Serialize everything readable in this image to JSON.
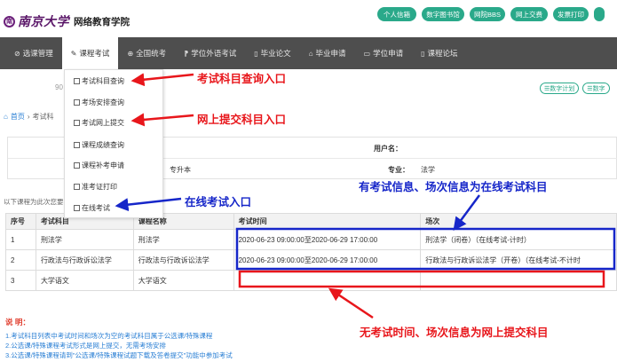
{
  "header": {
    "logo_mark": "南",
    "univ_name": "南京大学",
    "school_name": "网络教育学院",
    "buttons": [
      "个人信箱",
      "数字图书馆",
      "网院BBS",
      "网上交费",
      "发票打印"
    ]
  },
  "nav": {
    "items": [
      {
        "icon": "⊘",
        "label": "选课管理"
      },
      {
        "icon": "✎",
        "label": "课程考试"
      },
      {
        "icon": "⊕",
        "label": "全国统考"
      },
      {
        "icon": "⁋",
        "label": "学位外语考试"
      },
      {
        "icon": "▯",
        "label": "毕业论文"
      },
      {
        "icon": "⌂",
        "label": "毕业申请"
      },
      {
        "icon": "▭",
        "label": "学位申请"
      },
      {
        "icon": "▯",
        "label": "课程论坛"
      }
    ]
  },
  "dropdown": {
    "items": [
      "考试科目查询",
      "考场安排查询",
      "考试网上提交",
      "课程成绩查询",
      "课程补考申请",
      "准考证打印",
      "在线考试"
    ]
  },
  "breadcrumb": {
    "home": "首页",
    "current": "考试科"
  },
  "left_number": "90",
  "plan_buttons": [
    "数字计划",
    "数字"
  ],
  "info": {
    "username_label": "用户名：",
    "username_value": "",
    "level": "专升本",
    "major_label": "专业：",
    "major_value": "法学"
  },
  "hint": "以下课程为此次您要",
  "table": {
    "headers": [
      "序号",
      "考试科目",
      "课程名称",
      "考试时间",
      "场次"
    ],
    "rows": [
      [
        "1",
        "刑法学",
        "刑法学",
        "2020-06-23 09:00:00至2020-06-29 17:00:00",
        "刑法学（闭卷）（在线考试-计时）"
      ],
      [
        "2",
        "行政法与行政诉讼法学",
        "行政法与行政诉讼法学",
        "2020-06-23 09:00:00至2020-06-29 17:00:00",
        "行政法与行政诉讼法学（开卷）（在线考试-不计时"
      ],
      [
        "3",
        "大学语文",
        "大学语文",
        "",
        ""
      ]
    ]
  },
  "notes": {
    "title": "说 明：",
    "lines": [
      "1.考试科目列表中考试时间和场次为空的考试科目属于公选课/特殊课程",
      "2.公选课/特殊课程考试形式是网上提交，无需考场安排",
      "3.公选课/特殊课程请到\"公选课/特殊课程试题下载及答卷提交\"功能中参加考试"
    ]
  },
  "annotations": {
    "query_entry": "考试科目查询入口",
    "submit_entry": "网上提交科目入口",
    "online_entry": "在线考试入口",
    "online_info": "有考试信息、场次信息为在线考试科目",
    "submit_info": "无考试时间、场次信息为网上提交科目",
    "red_color": "#e8161b",
    "blue_color": "#1626c9"
  }
}
